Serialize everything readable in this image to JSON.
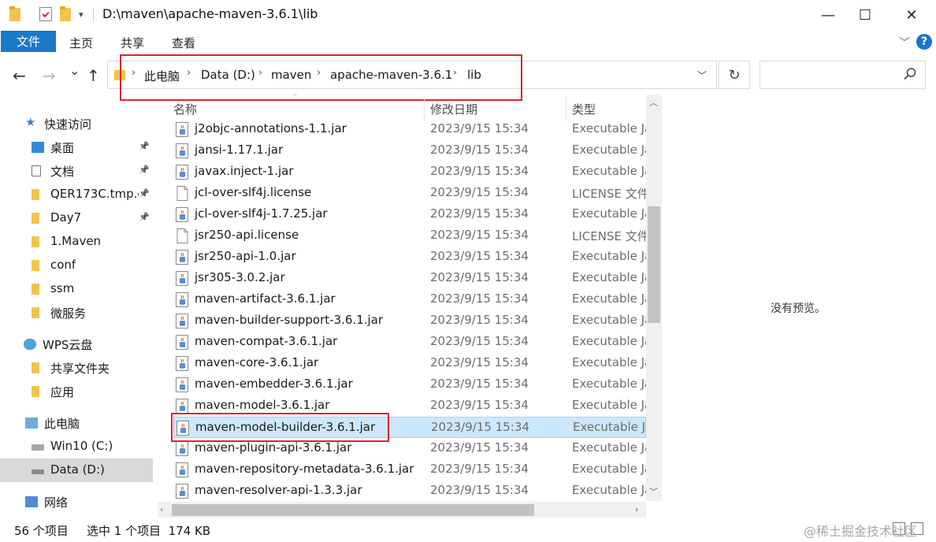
{
  "window": {
    "title": "D:\\maven\\apache-maven-3.6.1\\lib",
    "minimize": "—",
    "maximize": "☐",
    "close": "✕"
  },
  "ribbon": {
    "tabs": [
      "文件",
      "主页",
      "共享",
      "查看"
    ],
    "help": "?"
  },
  "nav": {
    "back": "←",
    "forward": "→",
    "recent": "⌄",
    "up": "↑",
    "breadcrumb": [
      "此电脑",
      "Data (D:)",
      "maven",
      "apache-maven-3.6.1",
      "lib"
    ],
    "separator": "›",
    "refresh": "↻",
    "search_placeholder": ""
  },
  "sidebar": {
    "items": [
      {
        "label": "快速访问",
        "icon": "star-icon",
        "pinned": false
      },
      {
        "label": "桌面",
        "icon": "desktop-icon",
        "pinned": true
      },
      {
        "label": "文档",
        "icon": "documents-icon",
        "pinned": true
      },
      {
        "label": "QER173C.tmp.c",
        "icon": "folder-icon",
        "pinned": true
      },
      {
        "label": "Day7",
        "icon": "folder-icon",
        "pinned": true
      },
      {
        "label": "1.Maven",
        "icon": "folder-icon",
        "pinned": false
      },
      {
        "label": "conf",
        "icon": "folder-icon",
        "pinned": false
      },
      {
        "label": "ssm",
        "icon": "folder-icon",
        "pinned": false
      },
      {
        "label": "微服务",
        "icon": "folder-icon",
        "pinned": false
      },
      {
        "label": "WPS云盘",
        "icon": "cloud-icon",
        "pinned": false
      },
      {
        "label": "共享文件夹",
        "icon": "shared-folder-icon",
        "pinned": false
      },
      {
        "label": "应用",
        "icon": "folder-icon",
        "pinned": false
      },
      {
        "label": "此电脑",
        "icon": "computer-icon",
        "pinned": false
      },
      {
        "label": "Win10 (C:)",
        "icon": "windows-drive-icon",
        "pinned": false
      },
      {
        "label": "Data (D:)",
        "icon": "drive-icon",
        "pinned": false,
        "selected": true
      },
      {
        "label": "网络",
        "icon": "network-icon",
        "pinned": false
      }
    ]
  },
  "columns": {
    "name": "名称",
    "date": "修改日期",
    "type": "类型"
  },
  "files": [
    {
      "name": "j2objc-annotations-1.1.jar",
      "date": "2023/9/15 15:34",
      "type": "Executable Jar File",
      "kind": "jar"
    },
    {
      "name": "jansi-1.17.1.jar",
      "date": "2023/9/15 15:34",
      "type": "Executable Jar File",
      "kind": "jar"
    },
    {
      "name": "javax.inject-1.jar",
      "date": "2023/9/15 15:34",
      "type": "Executable Jar File",
      "kind": "jar"
    },
    {
      "name": "jcl-over-slf4j.license",
      "date": "2023/9/15 15:34",
      "type": "LICENSE 文件",
      "kind": "file"
    },
    {
      "name": "jcl-over-slf4j-1.7.25.jar",
      "date": "2023/9/15 15:34",
      "type": "Executable Jar File",
      "kind": "jar"
    },
    {
      "name": "jsr250-api.license",
      "date": "2023/9/15 15:34",
      "type": "LICENSE 文件",
      "kind": "file"
    },
    {
      "name": "jsr250-api-1.0.jar",
      "date": "2023/9/15 15:34",
      "type": "Executable Jar File",
      "kind": "jar"
    },
    {
      "name": "jsr305-3.0.2.jar",
      "date": "2023/9/15 15:34",
      "type": "Executable Jar File",
      "kind": "jar"
    },
    {
      "name": "maven-artifact-3.6.1.jar",
      "date": "2023/9/15 15:34",
      "type": "Executable Jar File",
      "kind": "jar"
    },
    {
      "name": "maven-builder-support-3.6.1.jar",
      "date": "2023/9/15 15:34",
      "type": "Executable Jar File",
      "kind": "jar"
    },
    {
      "name": "maven-compat-3.6.1.jar",
      "date": "2023/9/15 15:34",
      "type": "Executable Jar File",
      "kind": "jar"
    },
    {
      "name": "maven-core-3.6.1.jar",
      "date": "2023/9/15 15:34",
      "type": "Executable Jar File",
      "kind": "jar"
    },
    {
      "name": "maven-embedder-3.6.1.jar",
      "date": "2023/9/15 15:34",
      "type": "Executable Jar File",
      "kind": "jar"
    },
    {
      "name": "maven-model-3.6.1.jar",
      "date": "2023/9/15 15:34",
      "type": "Executable Jar File",
      "kind": "jar"
    },
    {
      "name": "maven-model-builder-3.6.1.jar",
      "date": "2023/9/15 15:34",
      "type": "Executable Jar File",
      "kind": "jar",
      "selected": true
    },
    {
      "name": "maven-plugin-api-3.6.1.jar",
      "date": "2023/9/15 15:34",
      "type": "Executable Jar File",
      "kind": "jar"
    },
    {
      "name": "maven-repository-metadata-3.6.1.jar",
      "date": "2023/9/15 15:34",
      "type": "Executable Jar File",
      "kind": "jar"
    },
    {
      "name": "maven-resolver-api-1.3.3.jar",
      "date": "2023/9/15 15:34",
      "type": "Executable Jar File",
      "kind": "jar"
    }
  ],
  "preview": {
    "empty_text": "没有预览。"
  },
  "status": {
    "item_count": "56 个项目",
    "selection": "选中 1 个项目  174 KB"
  },
  "watermark": "@稀土掘金技术社区",
  "colors": {
    "accent": "#1979ca",
    "selection_bg": "#cce8ff",
    "selection_border": "#99d1ff",
    "highlight_box": "#d9262d",
    "folder": "#f2c44d"
  }
}
